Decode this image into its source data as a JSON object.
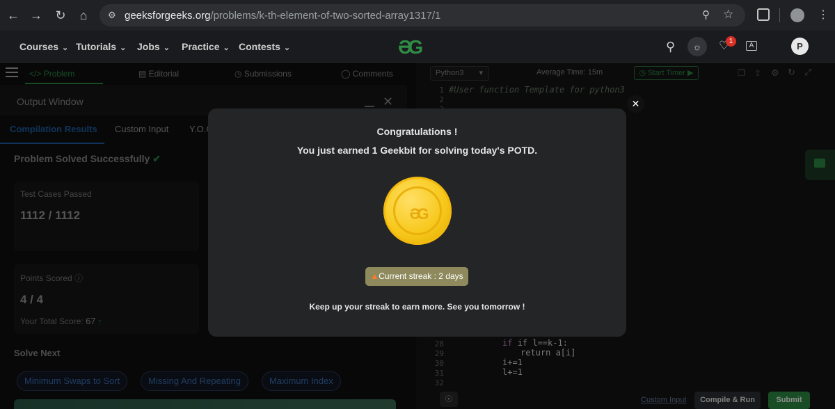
{
  "browser": {
    "url_host": "geeksforgeeks.org",
    "url_path": "/problems/k-th-element-of-two-sorted-array1317/1"
  },
  "header": {
    "nav": [
      "Courses",
      "Tutorials",
      "Jobs",
      "Practice",
      "Contests"
    ],
    "logo": "ƏG",
    "notification_count": "1",
    "avatar_letter": "P"
  },
  "tabs": {
    "problem": "Problem",
    "editorial": "Editorial",
    "submissions": "Submissions",
    "comments": "Comments"
  },
  "output": {
    "title": "Output Window",
    "subtabs": [
      "Compilation Results",
      "Custom Input",
      "Y.O.G"
    ],
    "status": "Problem Solved Successfully",
    "test_label": "Test Cases Passed",
    "test_value": "1112 / 1112",
    "points_label": "Points Scored",
    "points_value": "4 / 4",
    "total_label": "Your Total Score:",
    "total_value": "67",
    "solve_next": "Solve Next",
    "next_problems": [
      "Minimum Swaps to Sort",
      "Missing And Repeating",
      "Maximum Index"
    ]
  },
  "editor": {
    "language": "Python3",
    "avg_time": "Average Time: 15m",
    "start_timer": "Start Timer",
    "line1": "1",
    "line2": "2",
    "line3": "3",
    "code_line1": "#User function Template for python3",
    "bottom_lines": [
      {
        "n": "28",
        "code": "if l==k-1:"
      },
      {
        "n": "29",
        "code": "return a[i]"
      },
      {
        "n": "30",
        "code": "i+=1"
      },
      {
        "n": "31",
        "code": "l+=1"
      },
      {
        "n": "32",
        "code": ""
      }
    ],
    "custom_input": "Custom Input",
    "compile_run": "Compile & Run",
    "submit": "Submit"
  },
  "modal": {
    "title": "Congratulations !",
    "subtitle": "You just earned 1 Geekbit for solving today's POTD.",
    "coin_logo": "ƏG",
    "streak": "Current streak : 2 days",
    "footer": "Keep up your streak to earn more. See you tomorrow !"
  },
  "colors": {
    "brand_green": "#2f8d46",
    "link_blue": "#3d6fb6",
    "coin_gold": "#f7c81b",
    "streak_bg": "#8e8a5e"
  }
}
